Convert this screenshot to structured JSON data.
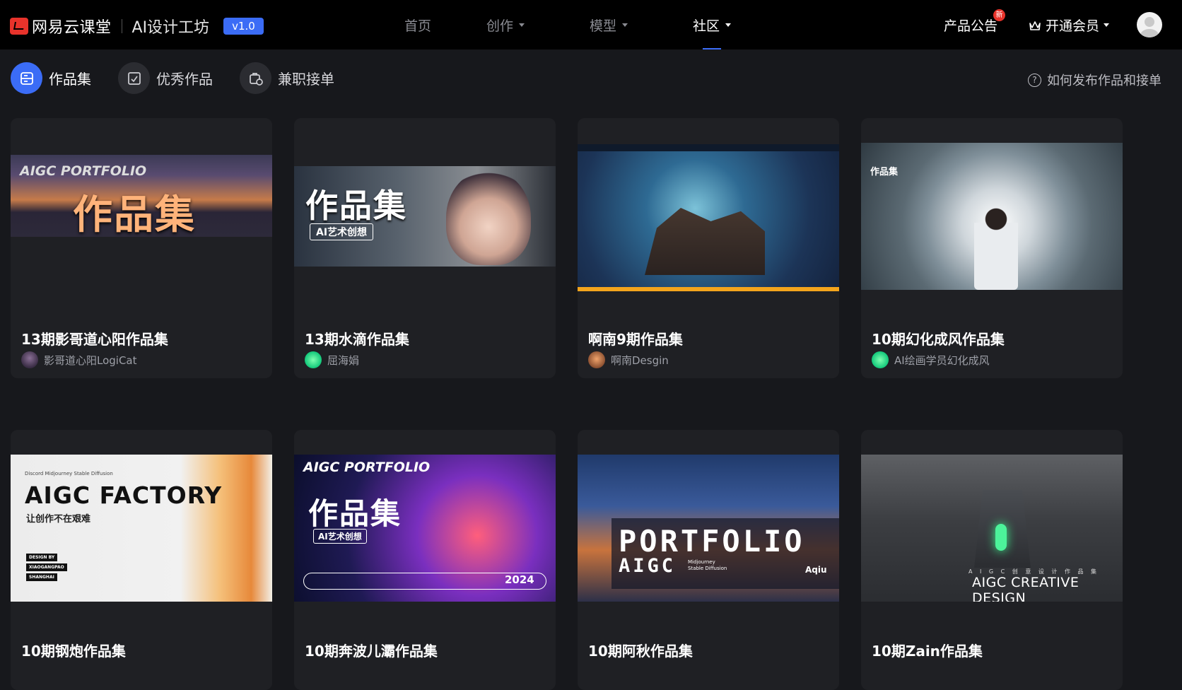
{
  "header": {
    "brand_name": "网易云课堂",
    "brand_sub": "AI设计工坊",
    "version": "v1.0",
    "nav": [
      {
        "label": "首页",
        "has_caret": false
      },
      {
        "label": "创作",
        "has_caret": true
      },
      {
        "label": "模型",
        "has_caret": true
      },
      {
        "label": "社区",
        "has_caret": true,
        "active": true
      }
    ],
    "notice_label": "产品公告",
    "notice_badge": "新",
    "vip_label": "开通会员"
  },
  "tabs": [
    {
      "label": "作品集",
      "icon": "portfolio-icon",
      "active": true
    },
    {
      "label": "优秀作品",
      "icon": "excellent-work-icon",
      "active": false
    },
    {
      "label": "兼职接单",
      "icon": "part-time-job-icon",
      "active": false
    }
  ],
  "help_text": "如何发布作品和接单",
  "cards": [
    {
      "title": "13期影哥道心阳作品集",
      "author": "影哥道心阳LogiCat",
      "thumb_text": {
        "head": "AIGC PORTFOLIO",
        "big": "作品集"
      }
    },
    {
      "title": "13期水滴作品集",
      "author": "屈海娟",
      "thumb_text": {
        "big": "作品集",
        "sub": "AI艺术创想"
      }
    },
    {
      "title": "啊南9期作品集",
      "author": "啊南Desgin",
      "thumb_text": {}
    },
    {
      "title": "10期幻化成风作品集",
      "author": "AI绘画学员幻化成风",
      "thumb_text": {
        "label": "作品集"
      }
    },
    {
      "title": "10期钢炮作品集",
      "author": "",
      "thumb_text": {
        "brands": "Discord   Midjourney   Stable Diffusion",
        "title": "AIGC FACTORY",
        "sub": "让创作不在艰难",
        "tags": [
          "DESIGN BY",
          "XIAOGANGPAO",
          "SHANGHAI"
        ]
      }
    },
    {
      "title": "10期奔波儿灞作品集",
      "author": "",
      "thumb_text": {
        "head": "AIGC PORTFOLIO",
        "big": "作品集",
        "sub": "AI艺术创想",
        "year": "2024"
      }
    },
    {
      "title": "10期阿秋作品集",
      "author": "",
      "thumb_text": {
        "big": "PORTFOLIO",
        "aigc": "AIGC",
        "small": "Midjourney\nStable Diffusion",
        "name": "Aqiu"
      }
    },
    {
      "title": "10期Zain作品集",
      "author": "",
      "thumb_text": {
        "small": "A I G C   创 意 设 计 作 品 集",
        "title": "AIGC CREATIVE DESIGN"
      }
    }
  ],
  "colors": {
    "accent": "#3b6cf6",
    "brand_red": "#e8332b",
    "bg": "#17181c",
    "card_bg": "#1f2024"
  }
}
